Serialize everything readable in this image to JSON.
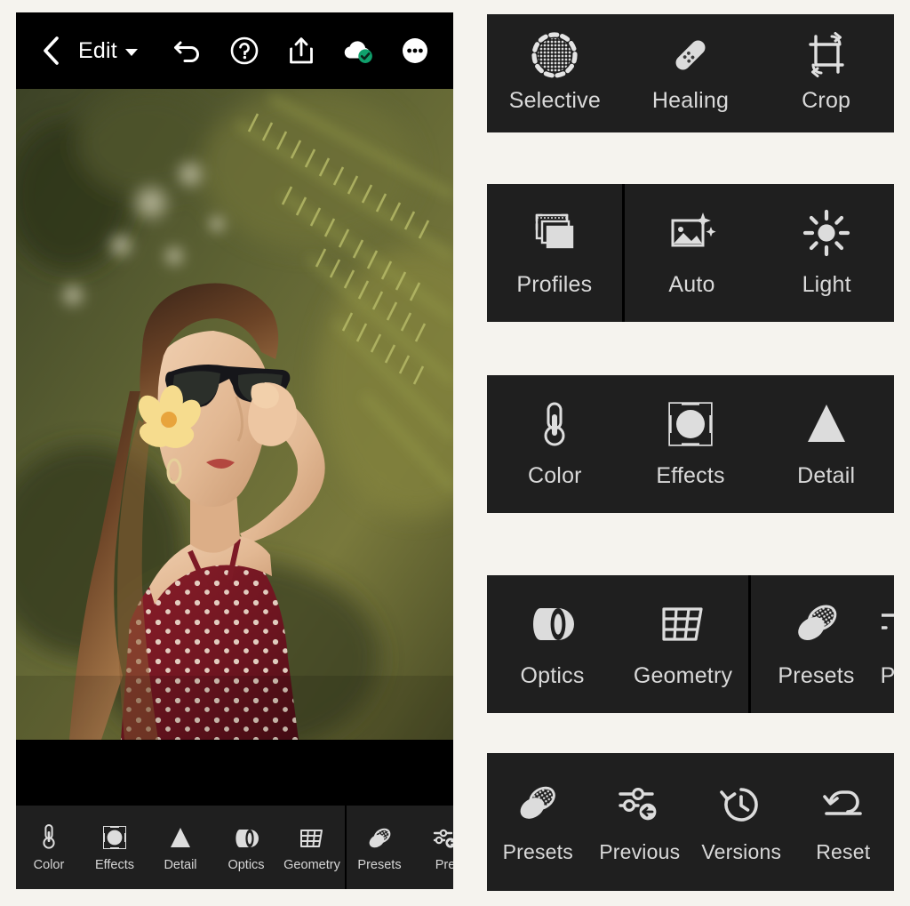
{
  "app": {
    "background_color": "#f5f3ee",
    "panel_color": "#1f1f1f",
    "label_color": "#d9d9d9",
    "accent_sync_color": "#10a06c"
  },
  "phone": {
    "topbar": {
      "back_icon": "chevron-left-icon",
      "title": "Edit",
      "dropdown_icon": "caret-down-icon",
      "actions": [
        {
          "name": "undo-icon",
          "label": "Undo"
        },
        {
          "name": "help-icon",
          "label": "Help"
        },
        {
          "name": "share-icon",
          "label": "Share"
        },
        {
          "name": "cloud-synced-icon",
          "label": "Synced"
        },
        {
          "name": "more-options-icon",
          "label": "More"
        }
      ]
    },
    "photo": {
      "alt": "Woman with yellow plumeria flower in hair wearing sunglasses and red polka dot dress in front of tropical ferns"
    },
    "bottombar": {
      "items": [
        {
          "label": "Color",
          "icon": "thermometer-icon"
        },
        {
          "label": "Effects",
          "icon": "vignette-icon"
        },
        {
          "label": "Detail",
          "icon": "triangle-icon"
        },
        {
          "label": "Optics",
          "icon": "lens-icon"
        },
        {
          "label": "Geometry",
          "icon": "perspective-grid-icon"
        }
      ],
      "items_after_divider": [
        {
          "label": "Presets",
          "icon": "presets-icon"
        },
        {
          "label": "Pre",
          "icon": "previous-icon"
        }
      ]
    }
  },
  "panels": [
    {
      "name": "tools-panel",
      "items": [
        {
          "label": "Selective",
          "icon": "selective-icon"
        },
        {
          "label": "Healing",
          "icon": "healing-bandage-icon"
        },
        {
          "label": "Crop",
          "icon": "crop-icon"
        }
      ],
      "divider_after_index": null
    },
    {
      "name": "profiles-panel",
      "items": [
        {
          "label": "Profiles",
          "icon": "profiles-icon"
        },
        {
          "label": "Auto",
          "icon": "auto-enhance-icon"
        },
        {
          "label": "Light",
          "icon": "sun-icon"
        }
      ],
      "divider_after_index": 0
    },
    {
      "name": "adjust-panel",
      "items": [
        {
          "label": "Color",
          "icon": "thermometer-icon"
        },
        {
          "label": "Effects",
          "icon": "vignette-icon"
        },
        {
          "label": "Detail",
          "icon": "triangle-icon"
        }
      ],
      "divider_after_index": null
    },
    {
      "name": "optics-panel",
      "items": [
        {
          "label": "Optics",
          "icon": "lens-icon"
        },
        {
          "label": "Geometry",
          "icon": "perspective-grid-icon"
        },
        {
          "label": "Presets",
          "icon": "presets-icon"
        }
      ],
      "divider_after_index": 1,
      "cutoff_item": {
        "label": "P",
        "icon": "previous-icon"
      }
    },
    {
      "name": "presets-history-panel",
      "items": [
        {
          "label": "Presets",
          "icon": "presets-icon"
        },
        {
          "label": "Previous",
          "icon": "previous-icon"
        },
        {
          "label": "Versions",
          "icon": "versions-clock-icon"
        },
        {
          "label": "Reset",
          "icon": "reset-undo-icon"
        }
      ],
      "divider_after_index": null
    }
  ]
}
